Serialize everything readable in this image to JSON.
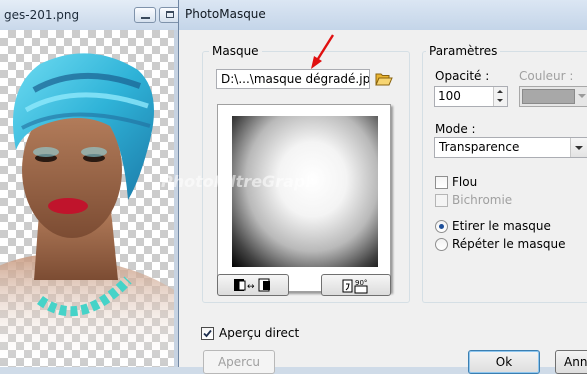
{
  "background_window": {
    "title": "ges-201.png"
  },
  "dialog": {
    "title": "PhotoMasque",
    "watermark": "PhotoFiltreGraphic",
    "masque": {
      "group_title": "Masque",
      "file_value": "D:\\...\\masque dégradé.jpg"
    },
    "parametres": {
      "group_title": "Paramètres",
      "opacite_label": "Opacité :",
      "opacite_value": "100",
      "couleur_label": "Couleur :",
      "couleur_color": "#a8a8a8",
      "mode_label": "Mode :",
      "mode_value": "Transparence",
      "flou_label": "Flou",
      "bichromie_label": "Bichromie",
      "etirer_label": "Etirer le masque",
      "repeter_label": "Répéter le masque"
    },
    "apercu_direct_label": "Aperçu direct",
    "apercu_button": "Apercu",
    "ok_button": "Ok",
    "cancel_button_partial": "Ann"
  },
  "colors": {
    "arrow": "#e01010",
    "radio_selected": "#1e4f99",
    "turban": "#36bfe0"
  },
  "icons": {
    "folder": "folder-open-icon",
    "invert": "invert-mask-icon",
    "rotate": "rotate-90-icon",
    "minimize": "minimize-icon",
    "maximize": "maximize-icon"
  }
}
